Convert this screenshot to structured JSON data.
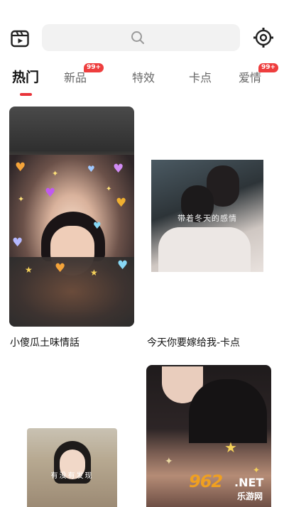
{
  "header": {
    "app_icon": "clapperboard-icon",
    "search_icon": "search-icon",
    "settings_icon": "gear-icon"
  },
  "tabs": [
    {
      "label": "热门",
      "active": true
    },
    {
      "label": "新品",
      "badge": "99+"
    },
    {
      "label": "特效"
    },
    {
      "label": "卡点"
    },
    {
      "label": "爱情",
      "badge": "99+"
    }
  ],
  "cards": [
    {
      "caption": "小傻瓜土味情話"
    },
    {
      "caption": "今天你要嫁给我-卡点",
      "overlay": "带着冬天的感情"
    },
    {
      "overlay": "有没有发现"
    },
    {}
  ],
  "watermark": {
    "num": "962",
    "suffix": ".NET",
    "cn": "乐游网"
  },
  "colors": {
    "accent": "#e8343a",
    "badge": "#ee3e3e",
    "search_bg": "#f2f2f2"
  }
}
